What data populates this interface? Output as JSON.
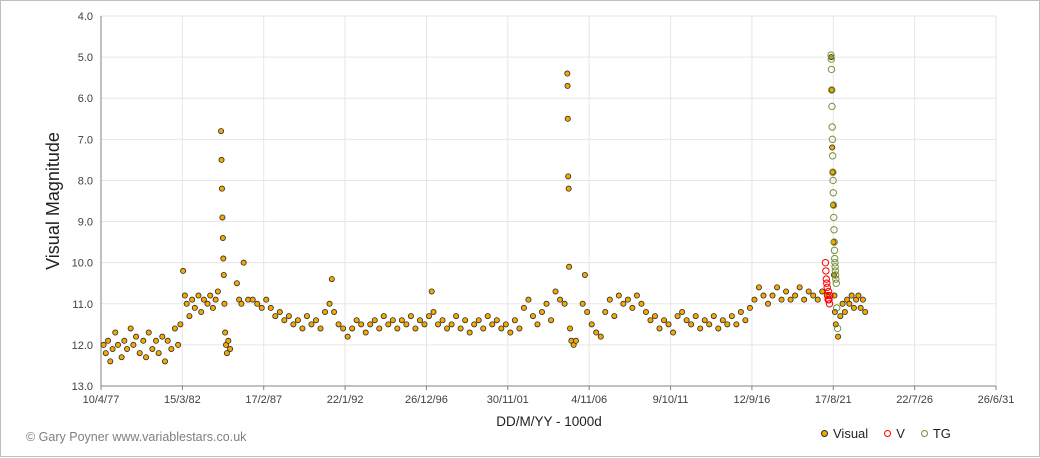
{
  "chart_data": {
    "type": "scatter",
    "title": "",
    "xlabel": "DD/M/YY - 1000d",
    "ylabel": "Visual Magnitude",
    "x_ticks": [
      "10/4/77",
      "15/3/82",
      "17/2/87",
      "22/1/92",
      "26/12/96",
      "30/11/01",
      "4/11/06",
      "9/10/11",
      "12/9/16",
      "17/8/21",
      "22/7/26",
      "26/6/31"
    ],
    "x_tick_jd": [
      2443244,
      2445044,
      2446844,
      2448644,
      2450444,
      2452244,
      2454044,
      2455844,
      2457644,
      2459444,
      2461244,
      2463044
    ],
    "x_axis_units": "Julian Date",
    "y_ticks": [
      "4.0",
      "5.0",
      "6.0",
      "7.0",
      "8.0",
      "9.0",
      "10.0",
      "11.0",
      "12.0",
      "13.0"
    ],
    "ylim": [
      4.0,
      13.0
    ],
    "y_inverted": true,
    "grid": true,
    "legend_position": "bottom-right",
    "series": [
      {
        "name": "Visual",
        "color": "#f5a800",
        "stroke": "#2b2b2b",
        "marker": "filled-circle",
        "points": [
          [
            2443300,
            12.0
          ],
          [
            2443350,
            12.2
          ],
          [
            2443400,
            11.9
          ],
          [
            2443450,
            12.4
          ],
          [
            2443500,
            12.1
          ],
          [
            2443560,
            11.7
          ],
          [
            2443620,
            12.0
          ],
          [
            2443700,
            12.3
          ],
          [
            2443760,
            11.9
          ],
          [
            2443820,
            12.1
          ],
          [
            2443900,
            11.6
          ],
          [
            2443960,
            12.0
          ],
          [
            2444020,
            11.8
          ],
          [
            2444100,
            12.2
          ],
          [
            2444180,
            11.9
          ],
          [
            2444240,
            12.3
          ],
          [
            2444300,
            11.7
          ],
          [
            2444380,
            12.1
          ],
          [
            2444460,
            11.9
          ],
          [
            2444520,
            12.2
          ],
          [
            2444600,
            11.8
          ],
          [
            2444660,
            12.4
          ],
          [
            2444720,
            11.9
          ],
          [
            2444800,
            12.1
          ],
          [
            2444880,
            11.6
          ],
          [
            2444950,
            12.0
          ],
          [
            2445000,
            11.5
          ],
          [
            2445060,
            10.2
          ],
          [
            2445100,
            10.8
          ],
          [
            2445140,
            11.0
          ],
          [
            2445200,
            11.3
          ],
          [
            2445260,
            10.9
          ],
          [
            2445320,
            11.1
          ],
          [
            2445400,
            10.8
          ],
          [
            2445460,
            11.2
          ],
          [
            2445520,
            10.9
          ],
          [
            2445600,
            11.0
          ],
          [
            2445660,
            10.8
          ],
          [
            2445720,
            11.1
          ],
          [
            2445780,
            10.9
          ],
          [
            2445830,
            10.7
          ],
          [
            2445900,
            6.8
          ],
          [
            2445910,
            7.5
          ],
          [
            2445920,
            8.2
          ],
          [
            2445930,
            8.9
          ],
          [
            2445940,
            9.4
          ],
          [
            2445950,
            9.9
          ],
          [
            2445960,
            10.3
          ],
          [
            2445975,
            11.0
          ],
          [
            2445990,
            11.7
          ],
          [
            2446010,
            12.0
          ],
          [
            2446030,
            12.2
          ],
          [
            2446060,
            11.9
          ],
          [
            2446100,
            12.1
          ],
          [
            2446250,
            10.5
          ],
          [
            2446300,
            10.9
          ],
          [
            2446350,
            11.0
          ],
          [
            2446400,
            10.0
          ],
          [
            2446500,
            10.9
          ],
          [
            2446600,
            10.9
          ],
          [
            2446700,
            11.0
          ],
          [
            2446800,
            11.1
          ],
          [
            2446900,
            10.9
          ],
          [
            2447000,
            11.1
          ],
          [
            2447100,
            11.3
          ],
          [
            2447200,
            11.2
          ],
          [
            2447300,
            11.4
          ],
          [
            2447400,
            11.3
          ],
          [
            2447500,
            11.5
          ],
          [
            2447600,
            11.4
          ],
          [
            2447700,
            11.6
          ],
          [
            2447800,
            11.3
          ],
          [
            2447900,
            11.5
          ],
          [
            2448000,
            11.4
          ],
          [
            2448100,
            11.6
          ],
          [
            2448200,
            11.2
          ],
          [
            2448300,
            11.0
          ],
          [
            2448350,
            10.4
          ],
          [
            2448400,
            11.2
          ],
          [
            2448500,
            11.5
          ],
          [
            2448600,
            11.6
          ],
          [
            2448700,
            11.8
          ],
          [
            2448800,
            11.6
          ],
          [
            2448900,
            11.4
          ],
          [
            2449000,
            11.5
          ],
          [
            2449100,
            11.7
          ],
          [
            2449200,
            11.5
          ],
          [
            2449300,
            11.4
          ],
          [
            2449400,
            11.6
          ],
          [
            2449500,
            11.3
          ],
          [
            2449600,
            11.5
          ],
          [
            2449700,
            11.4
          ],
          [
            2449800,
            11.6
          ],
          [
            2449900,
            11.4
          ],
          [
            2450000,
            11.5
          ],
          [
            2450100,
            11.3
          ],
          [
            2450200,
            11.6
          ],
          [
            2450300,
            11.4
          ],
          [
            2450400,
            11.5
          ],
          [
            2450500,
            11.3
          ],
          [
            2450560,
            10.7
          ],
          [
            2450600,
            11.2
          ],
          [
            2450700,
            11.5
          ],
          [
            2450800,
            11.4
          ],
          [
            2450900,
            11.6
          ],
          [
            2451000,
            11.5
          ],
          [
            2451100,
            11.3
          ],
          [
            2451200,
            11.6
          ],
          [
            2451300,
            11.4
          ],
          [
            2451400,
            11.7
          ],
          [
            2451500,
            11.5
          ],
          [
            2451600,
            11.4
          ],
          [
            2451700,
            11.6
          ],
          [
            2451800,
            11.3
          ],
          [
            2451900,
            11.5
          ],
          [
            2452000,
            11.4
          ],
          [
            2452100,
            11.6
          ],
          [
            2452200,
            11.5
          ],
          [
            2452300,
            11.7
          ],
          [
            2452400,
            11.4
          ],
          [
            2452500,
            11.6
          ],
          [
            2452600,
            11.1
          ],
          [
            2452700,
            10.9
          ],
          [
            2452800,
            11.3
          ],
          [
            2452900,
            11.5
          ],
          [
            2453000,
            11.2
          ],
          [
            2453100,
            11.0
          ],
          [
            2453200,
            11.4
          ],
          [
            2453300,
            10.7
          ],
          [
            2453400,
            10.9
          ],
          [
            2453500,
            11.0
          ],
          [
            2453560,
            5.4
          ],
          [
            2453565,
            5.7
          ],
          [
            2453570,
            6.5
          ],
          [
            2453580,
            7.9
          ],
          [
            2453590,
            8.2
          ],
          [
            2453600,
            10.1
          ],
          [
            2453620,
            11.6
          ],
          [
            2453650,
            11.9
          ],
          [
            2453700,
            12.0
          ],
          [
            2453750,
            11.9
          ],
          [
            2453900,
            11.0
          ],
          [
            2453950,
            10.3
          ],
          [
            2454000,
            11.2
          ],
          [
            2454100,
            11.5
          ],
          [
            2454200,
            11.7
          ],
          [
            2454300,
            11.8
          ],
          [
            2454400,
            11.2
          ],
          [
            2454500,
            10.9
          ],
          [
            2454600,
            11.3
          ],
          [
            2454700,
            10.8
          ],
          [
            2454800,
            11.0
          ],
          [
            2454900,
            10.9
          ],
          [
            2455000,
            11.1
          ],
          [
            2455100,
            10.8
          ],
          [
            2455200,
            11.0
          ],
          [
            2455300,
            11.2
          ],
          [
            2455400,
            11.4
          ],
          [
            2455500,
            11.3
          ],
          [
            2455600,
            11.6
          ],
          [
            2455700,
            11.4
          ],
          [
            2455800,
            11.5
          ],
          [
            2455900,
            11.7
          ],
          [
            2456000,
            11.3
          ],
          [
            2456100,
            11.2
          ],
          [
            2456200,
            11.4
          ],
          [
            2456300,
            11.5
          ],
          [
            2456400,
            11.3
          ],
          [
            2456500,
            11.6
          ],
          [
            2456600,
            11.4
          ],
          [
            2456700,
            11.5
          ],
          [
            2456800,
            11.3
          ],
          [
            2456900,
            11.6
          ],
          [
            2457000,
            11.4
          ],
          [
            2457100,
            11.5
          ],
          [
            2457200,
            11.3
          ],
          [
            2457300,
            11.5
          ],
          [
            2457400,
            11.2
          ],
          [
            2457500,
            11.4
          ],
          [
            2457600,
            11.1
          ],
          [
            2457700,
            10.9
          ],
          [
            2457800,
            10.6
          ],
          [
            2457900,
            10.8
          ],
          [
            2458000,
            11.0
          ],
          [
            2458100,
            10.8
          ],
          [
            2458200,
            10.6
          ],
          [
            2458300,
            10.9
          ],
          [
            2458400,
            10.7
          ],
          [
            2458500,
            10.9
          ],
          [
            2458600,
            10.8
          ],
          [
            2458700,
            10.6
          ],
          [
            2458800,
            10.9
          ],
          [
            2458900,
            10.7
          ],
          [
            2459000,
            10.8
          ],
          [
            2459100,
            10.9
          ],
          [
            2459200,
            10.7
          ],
          [
            2459300,
            10.8
          ],
          [
            2459400,
            5.0
          ],
          [
            2459410,
            5.8
          ],
          [
            2459420,
            7.2
          ],
          [
            2459430,
            7.8
          ],
          [
            2459440,
            8.6
          ],
          [
            2459450,
            9.5
          ],
          [
            2459460,
            10.3
          ],
          [
            2459470,
            10.8
          ],
          [
            2459480,
            11.2
          ],
          [
            2459500,
            11.5
          ],
          [
            2459550,
            11.8
          ],
          [
            2459600,
            11.3
          ],
          [
            2459650,
            11.0
          ],
          [
            2459700,
            11.2
          ],
          [
            2459750,
            10.9
          ],
          [
            2459800,
            11.0
          ],
          [
            2459850,
            10.8
          ],
          [
            2459900,
            11.1
          ],
          [
            2459950,
            10.9
          ],
          [
            2460000,
            10.8
          ],
          [
            2460050,
            11.1
          ],
          [
            2460100,
            10.9
          ],
          [
            2460150,
            11.2
          ]
        ]
      },
      {
        "name": "V",
        "color": "#ff0000",
        "marker": "open-circle",
        "points": [
          [
            2459270,
            10.0
          ],
          [
            2459280,
            10.2
          ],
          [
            2459290,
            10.4
          ],
          [
            2459300,
            10.5
          ],
          [
            2459310,
            10.6
          ],
          [
            2459320,
            10.8
          ],
          [
            2459330,
            10.9
          ],
          [
            2459340,
            10.7
          ],
          [
            2459350,
            10.9
          ],
          [
            2459360,
            11.0
          ],
          [
            2459370,
            10.8
          ]
        ]
      },
      {
        "name": "TG",
        "color": "#76923c",
        "marker": "open-circle",
        "points": [
          [
            2459395,
            4.95
          ],
          [
            2459400,
            5.05
          ],
          [
            2459405,
            5.3
          ],
          [
            2459410,
            5.8
          ],
          [
            2459415,
            6.2
          ],
          [
            2459420,
            6.7
          ],
          [
            2459425,
            7.0
          ],
          [
            2459430,
            7.4
          ],
          [
            2459435,
            7.8
          ],
          [
            2459440,
            8.0
          ],
          [
            2459445,
            8.3
          ],
          [
            2459450,
            8.6
          ],
          [
            2459455,
            8.9
          ],
          [
            2459460,
            9.2
          ],
          [
            2459465,
            9.5
          ],
          [
            2459470,
            9.7
          ],
          [
            2459475,
            9.9
          ],
          [
            2459480,
            10.0
          ],
          [
            2459485,
            10.1
          ],
          [
            2459490,
            10.2
          ],
          [
            2459495,
            10.3
          ],
          [
            2459500,
            10.4
          ],
          [
            2459510,
            10.5
          ],
          [
            2459520,
            11.1
          ],
          [
            2459540,
            11.6
          ]
        ]
      }
    ]
  },
  "credit": "© Gary Poyner  www.variablestars.co.uk"
}
